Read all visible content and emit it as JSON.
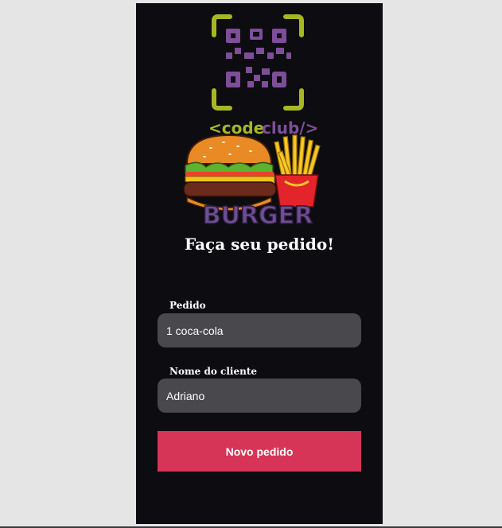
{
  "logo": {
    "brand_text_code": "<code",
    "brand_text_club": "club/>",
    "burger_word": "BURGER",
    "colors": {
      "qr_purple": "#7e4e99",
      "frame_lime": "#a6b723",
      "burger_purple": "#6f4f93"
    }
  },
  "form": {
    "title": "Faça seu pedido!",
    "order_label": "Pedido",
    "order_value": "1 coca-cola",
    "customer_label": "Nome do cliente",
    "customer_value": "Adriano",
    "submit_label": "Novo pedido"
  },
  "colors": {
    "background": "#0c0c11",
    "input_bg": "#48484d",
    "button_bg": "#d73557"
  }
}
